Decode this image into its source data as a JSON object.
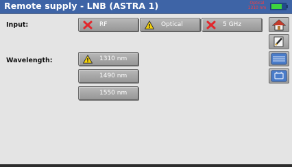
{
  "header": {
    "title": "Remote supply - LNB (ASTRA 1)",
    "status_line1": "Optical",
    "status_line2": "1310 nm",
    "status_color": "#ff3b3b",
    "battery_color": "#3ed23e"
  },
  "input": {
    "label": "Input:",
    "options": [
      {
        "label": "RF",
        "icon": "x-icon"
      },
      {
        "label": "Optical",
        "icon": "warning-icon"
      },
      {
        "label": "5 GHz",
        "icon": "x-icon"
      }
    ]
  },
  "wavelength": {
    "label": "Wavelength:",
    "options": [
      {
        "label": "1310 nm",
        "icon": "warning-icon"
      },
      {
        "label": "1490 nm"
      },
      {
        "label": "1550 nm"
      }
    ]
  },
  "side": {
    "icons": [
      "home-icon",
      "edit-icon",
      "ldb-icon",
      "tv-icon"
    ]
  }
}
